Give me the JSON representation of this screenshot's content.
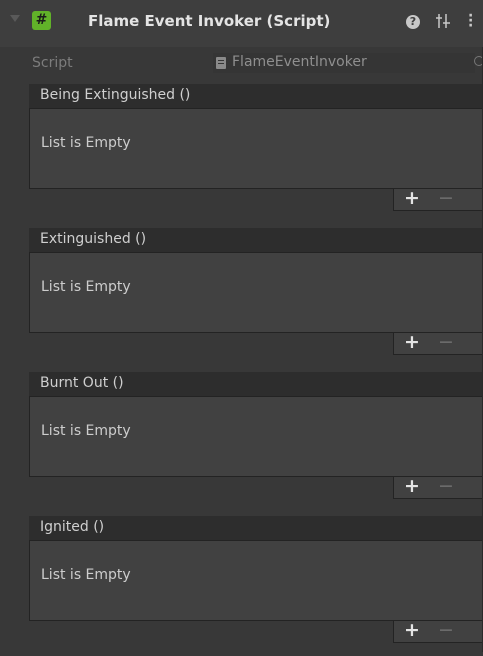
{
  "component": {
    "title": "Flame Event Invoker (Script)",
    "script_label": "Script",
    "script_value": "FlameEventInvoker",
    "help_icon_glyph": "?",
    "icons": [
      "foldout-arrow-icon",
      "csharp-script-icon",
      "help-icon",
      "preset-icon",
      "kebab-menu-icon",
      "script-file-icon",
      "object-picker-icon"
    ],
    "accent_color": "#61b229"
  },
  "events": [
    {
      "title": "Being Extinguished ()",
      "empty_label": "List is Empty",
      "add_label": "+",
      "remove_label": "−"
    },
    {
      "title": "Extinguished ()",
      "empty_label": "List is Empty",
      "add_label": "+",
      "remove_label": "−"
    },
    {
      "title": "Burnt Out ()",
      "empty_label": "List is Empty",
      "add_label": "+",
      "remove_label": "−"
    },
    {
      "title": "Ignited ()",
      "empty_label": "List is Empty",
      "add_label": "+",
      "remove_label": "−"
    }
  ]
}
